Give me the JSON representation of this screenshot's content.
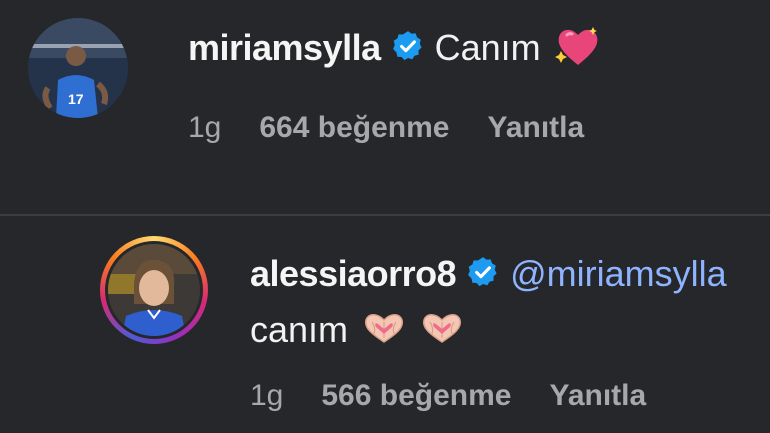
{
  "comments": [
    {
      "username": "miriamsylla",
      "text": "Canım",
      "emoji_icon": "sparkling-heart-icon",
      "time": "1g",
      "likes": "664 beğenme",
      "reply_label": "Yanıtla"
    },
    {
      "username": "alessiaorro8",
      "mention": "@miriamsylla",
      "text": "canım",
      "emoji_icons": [
        "heart-hands-icon",
        "heart-hands-icon"
      ],
      "time": "1g",
      "likes": "566 beğenme",
      "reply_label": "Yanıtla"
    }
  ],
  "colors": {
    "background": "#26272a",
    "verified_badge": "#1d9bf0",
    "mention": "#8fb4ff",
    "meta_text": "#a7a8ab"
  }
}
